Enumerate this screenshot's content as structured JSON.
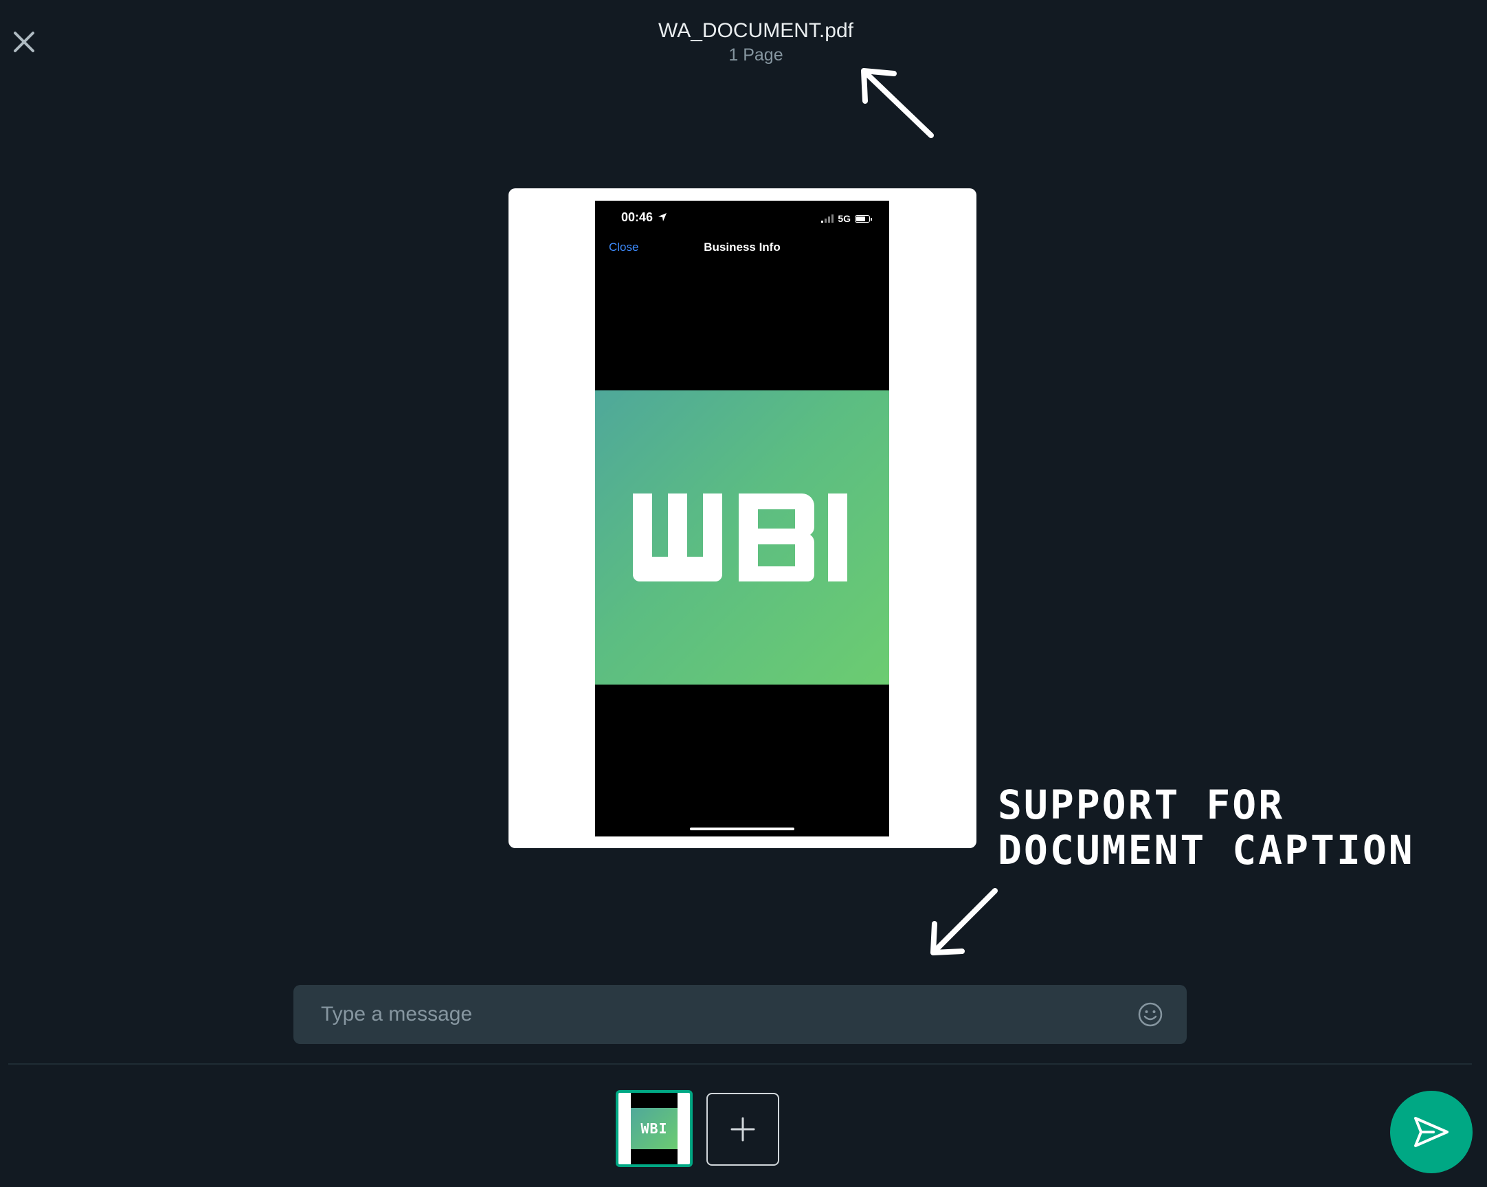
{
  "header": {
    "file_name": "WA_DOCUMENT.pdf",
    "page_count": "1 Page"
  },
  "preview": {
    "status_time": "00:46",
    "network": "5G",
    "nav_close": "Close",
    "nav_title": "Business Info",
    "logo_text": "WBI"
  },
  "annotation": {
    "line1": "SUPPORT FOR",
    "line2": "DOCUMENT CAPTION"
  },
  "composer": {
    "placeholder": "Type a message",
    "value": ""
  },
  "thumbnails": [
    {
      "logo_text": "WBI",
      "selected": true
    }
  ],
  "icons": {
    "close": "close-icon",
    "emoji": "emoji-icon",
    "add": "plus-icon",
    "send": "send-icon"
  },
  "colors": {
    "background": "#121a22",
    "accent": "#00a884",
    "input_bg": "#2a3942"
  }
}
